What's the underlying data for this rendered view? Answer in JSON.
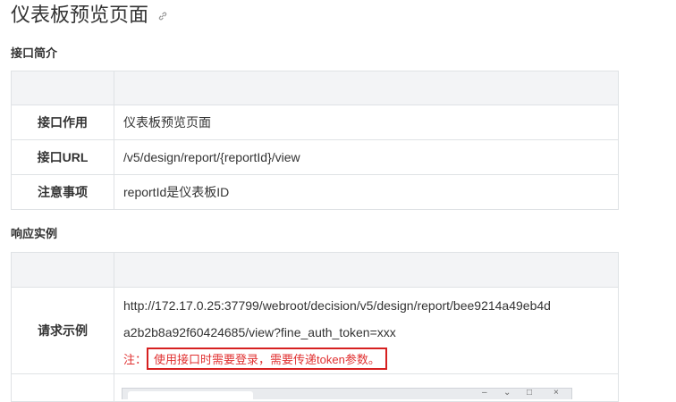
{
  "page": {
    "title": "仪表板预览页面"
  },
  "sections": {
    "intro_heading": "接口简介",
    "response_heading": "响应实例"
  },
  "intro_table": {
    "rows": [
      {
        "key": "接口作用",
        "value": "仪表板预览页面"
      },
      {
        "key": "接口URL",
        "value": "/v5/design/report/{reportId}/view"
      },
      {
        "key": "注意事项",
        "value": "reportId是仪表板ID"
      }
    ]
  },
  "response_table": {
    "request_example_key": "请求示例",
    "request_url_line1": "http://172.17.0.25:37799/webroot/decision/v5/design/report/bee9214a49eb4d",
    "request_url_line2": "a2b2b8a92f60424685/view?fine_auth_token=xxx",
    "note_prefix": "注：",
    "note_text": "使用接口时需要登录，需要传递token参数。"
  },
  "window_controls": {
    "minimize": "–",
    "maximize": "□",
    "close": "×"
  },
  "colors": {
    "header_bg": "#f3f4f6",
    "border": "#dfe2e5",
    "note_red": "#e03030"
  },
  "icons": {
    "anchor": "link-icon"
  }
}
